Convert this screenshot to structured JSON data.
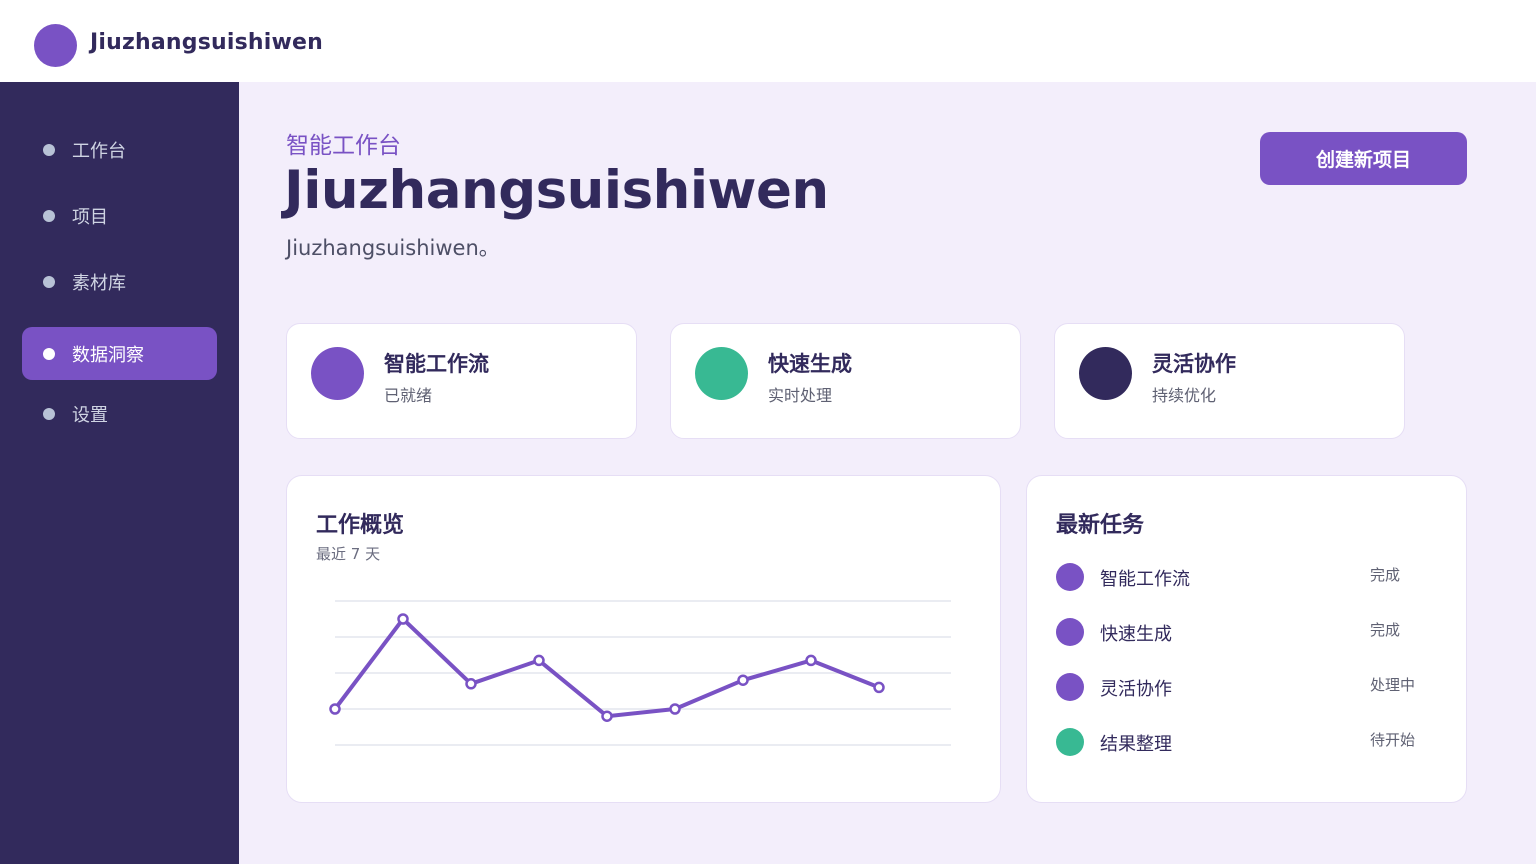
{
  "header": {
    "brand": "Jiuzhangsuishiwen"
  },
  "sidebar": {
    "items": [
      {
        "label": "工作台",
        "active": false
      },
      {
        "label": "项目",
        "active": false
      },
      {
        "label": "素材库",
        "active": false
      },
      {
        "label": "数据洞察",
        "active": true
      },
      {
        "label": "设置",
        "active": false
      }
    ]
  },
  "main": {
    "eyebrow": "智能工作台",
    "title": "Jiuzhangsuishiwen",
    "subtitle": "Jiuzhangsuishiwen。",
    "create_button": "创建新项目"
  },
  "stats": [
    {
      "title": "智能工作流",
      "sub": "已就绪",
      "color": "#7952c4"
    },
    {
      "title": "快速生成",
      "sub": "实时处理",
      "color": "#38b993"
    },
    {
      "title": "灵活协作",
      "sub": "持续优化",
      "color": "#322a5c"
    }
  ],
  "overview": {
    "title": "工作概览",
    "subtitle": "最近 7 天"
  },
  "chart_data": {
    "type": "line",
    "title": "工作概览",
    "subtitle": "最近 7 天",
    "xlabel": "",
    "ylabel": "",
    "ylim": [
      0,
      4
    ],
    "grid": true,
    "legend": "none",
    "series": [
      {
        "color": "#7952c4",
        "values": [
          1.0,
          3.5,
          1.7,
          2.35,
          0.8,
          1.0,
          1.8,
          2.35,
          1.6
        ]
      }
    ]
  },
  "tasks": {
    "title": "最新任务",
    "items": [
      {
        "name": "智能工作流",
        "status": "完成",
        "color": "#7952c4"
      },
      {
        "name": "快速生成",
        "status": "完成",
        "color": "#7952c4"
      },
      {
        "name": "灵活协作",
        "status": "处理中",
        "color": "#7952c4"
      },
      {
        "name": "结果整理",
        "status": "待开始",
        "color": "#38b993"
      }
    ]
  },
  "colors": {
    "accent": "#7952c4",
    "success": "#38b993",
    "navy": "#322a5c",
    "background": "#f3eefb"
  }
}
